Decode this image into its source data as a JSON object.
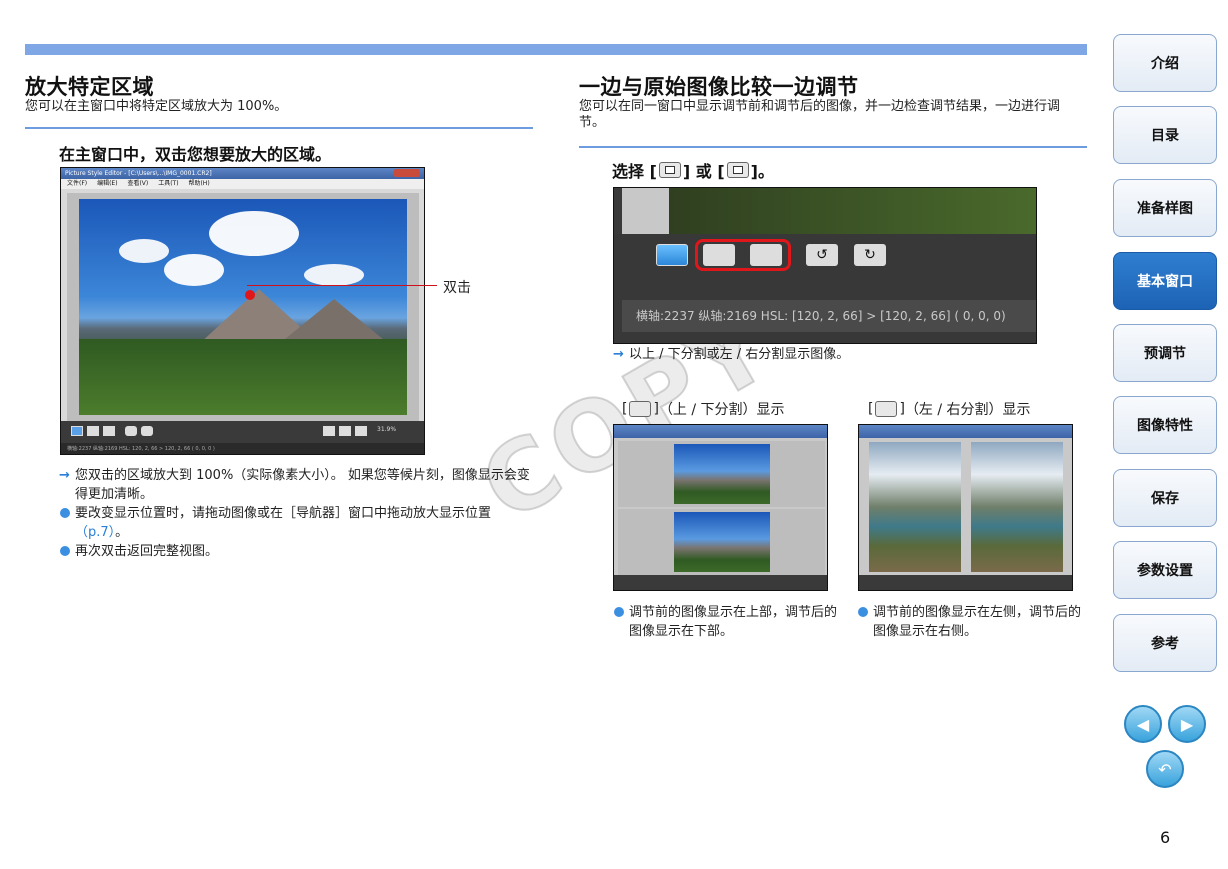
{
  "left": {
    "title": "放大特定区域",
    "desc": "您可以在主窗口中将特定区域放大为 100%。",
    "step": "在主窗口中，双击您想要放大的区域。",
    "callout": "双击",
    "screenshot": {
      "window_title": "Picture Style Editor - [C:\\Users\\...\\IMG_0001.CR2]",
      "menu": [
        "文件(F)",
        "编辑(E)",
        "查看(V)",
        "工具(T)",
        "帮助(H)"
      ],
      "zoom": "31.9%",
      "status": "横轴:2237 纵轴:2169  HSL: 120, 2, 66 > 120, 2, 66 ( 0, 0, 0 )"
    },
    "bullets": [
      {
        "type": "arrow",
        "text": "您双击的区域放大到 100%（实际像素大小）。 如果您等候片刻，图像显示会变得更加清晰。"
      },
      {
        "type": "dot",
        "text": "要改变显示位置时，请拖动图像或在［导航器］窗口中拖动放大显示位置",
        "link": "（p.7）",
        "tail": "。"
      },
      {
        "type": "dot",
        "text": "再次双击返回完整视图。"
      }
    ]
  },
  "right": {
    "title": "一边与原始图像比较一边调节",
    "desc": "您可以在同一窗口中显示调节前和调节后的图像，并一边检查调节结果，一边进行调节。",
    "step_prefix": "选择 [",
    "step_mid": "] 或 [",
    "step_suffix": "]。",
    "closeup_status": "横轴:2237 纵轴:2169  HSL: [120,  2, 66] > [120,  2, 66] (  0,  0,  0)",
    "arrow_note": "以上 / 下分割或左 / 右分割显示图像。",
    "caption_top_bottom": "（上 / 下分割）显示",
    "caption_left_right": "（左 / 右分割）显示",
    "bullet_top_bottom": "调节前的图像显示在上部，调节后的图像显示在下部。",
    "bullet_left_right": "调节前的图像显示在左侧，调节后的图像显示在右侧。"
  },
  "nav": {
    "items": [
      "介绍",
      "目录",
      "准备样图",
      "基本窗口",
      "预调节",
      "图像特性",
      "保存",
      "参数设置",
      "参考"
    ],
    "active_index": 3,
    "prev_icon": "◀",
    "next_icon": "▶",
    "return_icon": "↶"
  },
  "page_number": "6",
  "watermark": "COPY"
}
